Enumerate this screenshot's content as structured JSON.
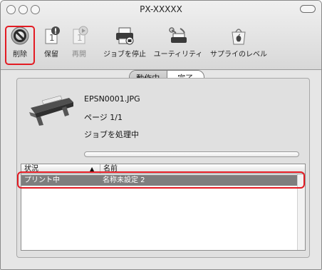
{
  "window": {
    "title": "PX-XXXXX"
  },
  "toolbar": {
    "delete": {
      "label": "削除",
      "icon": "delete-icon"
    },
    "hold": {
      "label": "保留",
      "icon": "hold-icon"
    },
    "resume": {
      "label": "再開",
      "icon": "resume-icon"
    },
    "stop_jobs": {
      "label": "ジョブを停止",
      "icon": "printer-stop-icon"
    },
    "utility": {
      "label": "ユーティリティ",
      "icon": "utility-icon"
    },
    "supply_levels": {
      "label": "サプライのレベル",
      "icon": "supply-levels-icon"
    }
  },
  "segmented": {
    "active_label": "動作中",
    "completed_label": "完了",
    "selected": "active"
  },
  "job": {
    "filename": "EPSN0001.JPG",
    "page_info": "ページ 1/1",
    "status": "ジョブを処理中"
  },
  "table": {
    "headers": {
      "status": "状況",
      "name": "名前"
    },
    "rows": [
      {
        "status": "プリント中",
        "name": "名称未設定 2"
      }
    ]
  },
  "colors": {
    "highlight_box": "#e31b23",
    "selected_row": "#7e7e7e"
  }
}
